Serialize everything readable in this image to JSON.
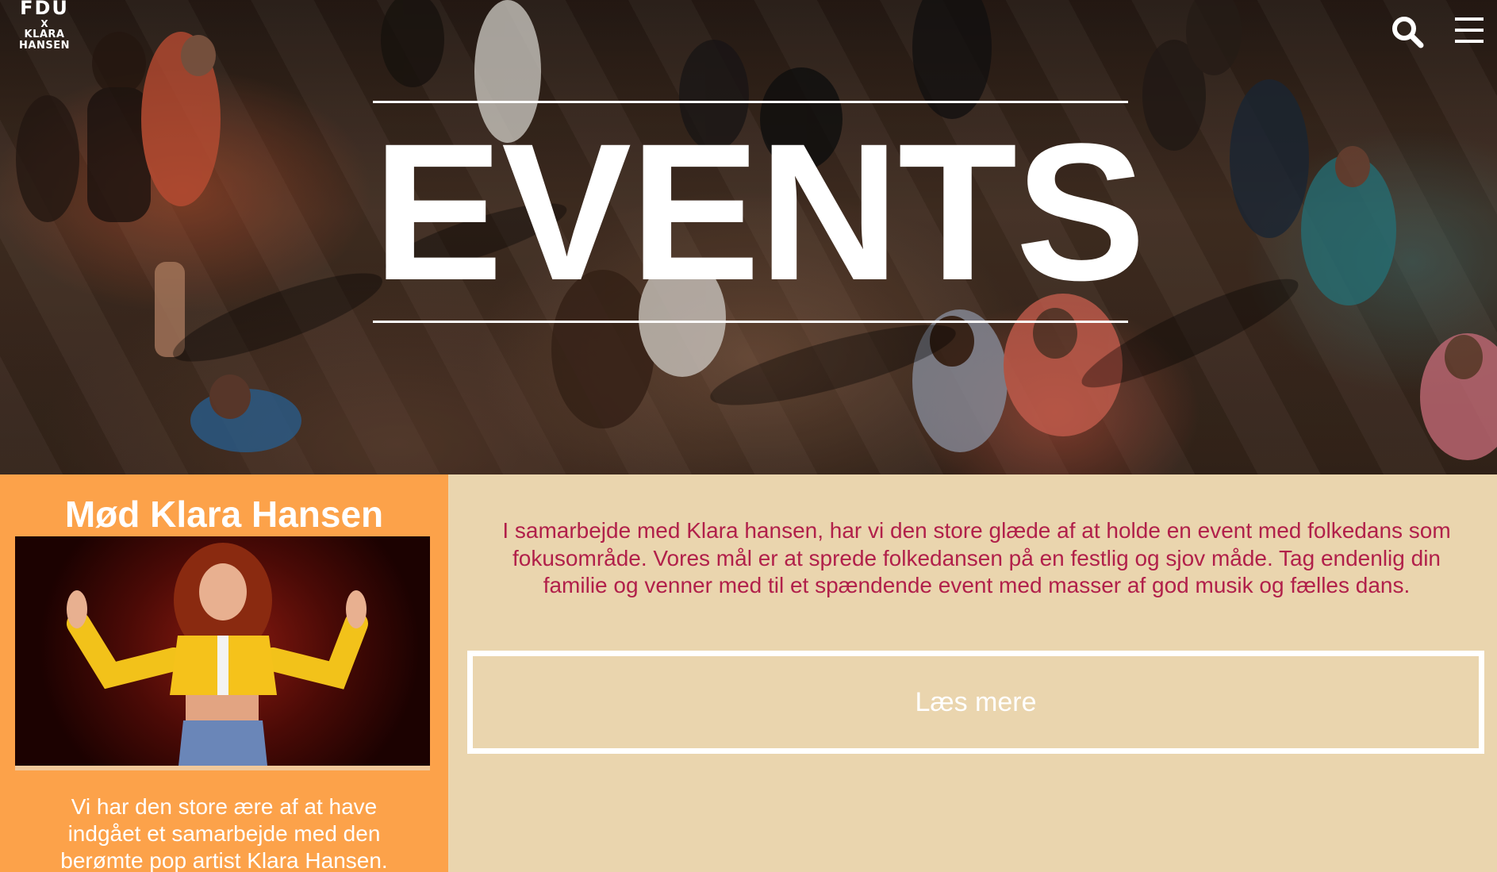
{
  "brand": {
    "logo_line1": "FDU",
    "logo_line2": "X",
    "logo_line3": "KLARA",
    "logo_line4": "HANSEN"
  },
  "header": {
    "search_icon": "search-icon",
    "menu_icon": "hamburger-menu-icon"
  },
  "hero": {
    "title": "EVENTS"
  },
  "feature": {
    "title": "Mød Klara Hansen",
    "text": "Vi har den store ære af at have indgået et samarbejde med den berømte pop artist Klara Hansen."
  },
  "main": {
    "intro": "I samarbejde med Klara hansen, har vi den store glæde af at holde en event med folkedans som fokusområde. Vores mål er at sprede folkedansen på en festlig og sjov måde. Tag endenlig din familie og venner med til et spændende event med masser af god musik og fælles dans.",
    "read_more_label": "Læs mere"
  },
  "colors": {
    "orange_panel": "#fca24a",
    "beige_background": "#ead5ae",
    "intro_text": "#b1204a",
    "white": "#ffffff"
  }
}
